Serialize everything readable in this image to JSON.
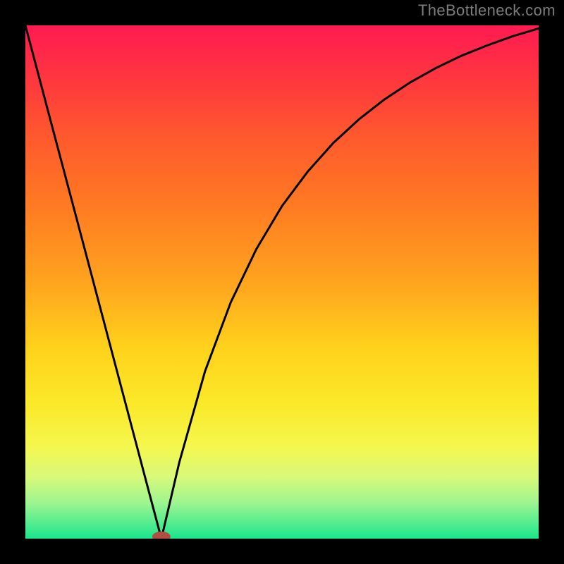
{
  "watermark": "TheBottleneck.com",
  "chart_data": {
    "type": "line",
    "title": "",
    "xlabel": "",
    "ylabel": "",
    "xlim": [
      0,
      100
    ],
    "ylim": [
      0,
      100
    ],
    "optimal_x": 26.5,
    "series": [
      {
        "name": "descending",
        "x": [
          0,
          5,
          10,
          15,
          20,
          24,
          26.5
        ],
        "values": [
          100,
          81.1,
          62.3,
          43.4,
          24.5,
          9.4,
          0
        ]
      },
      {
        "name": "ascending",
        "x": [
          26.5,
          30,
          35,
          40,
          45,
          50,
          55,
          60,
          65,
          70,
          75,
          80,
          85,
          90,
          95,
          100
        ],
        "values": [
          0,
          14.9,
          32.6,
          46.0,
          56.4,
          64.8,
          71.5,
          77.1,
          81.7,
          85.6,
          88.9,
          91.7,
          94.1,
          96.1,
          97.9,
          99.4
        ]
      }
    ],
    "marker": {
      "x": 26.5,
      "y": 0,
      "color": "#b24f44"
    },
    "background": {
      "gradient_stops": [
        {
          "pos": 0.0,
          "color": "#ff1a51"
        },
        {
          "pos": 0.5,
          "color": "#ffa41e"
        },
        {
          "pos": 0.82,
          "color": "#f5f74e"
        },
        {
          "pos": 1.0,
          "color": "#19e68d"
        }
      ]
    }
  }
}
